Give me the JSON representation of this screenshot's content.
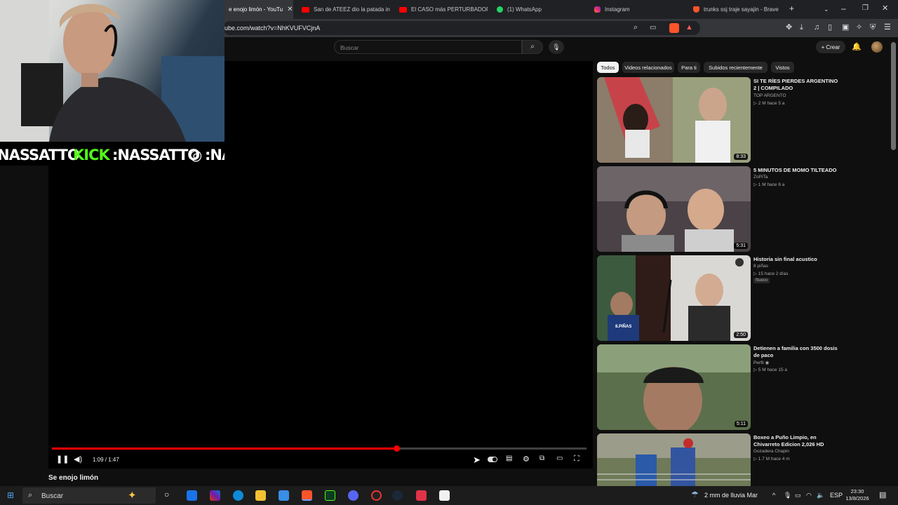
{
  "browser": {
    "tabs": [
      {
        "label": "e enojo limón - YouTu",
        "favicon": "youtube-icon",
        "color": "#ff0000",
        "active": true
      },
      {
        "label": "San de ATEEZ dio la patada in",
        "favicon": "youtube-icon",
        "color": "#ff0000"
      },
      {
        "label": "El CASO más PERTURBADOR d",
        "favicon": "youtube-icon",
        "color": "#ff0000"
      },
      {
        "label": "(1) WhatsApp",
        "favicon": "whatsapp-icon",
        "color": "#25d366"
      },
      {
        "label": "Instagram",
        "favicon": "instagram-icon",
        "color": "#e1306c"
      },
      {
        "label": "trunks ssj traje sayajin - Brave",
        "favicon": "brave-icon",
        "color": "#fb542b"
      }
    ],
    "url": "ube.com/watch?v=NhKVUFVCjnA"
  },
  "youtube": {
    "search_placeholder": "Buscar",
    "create_label": "Crear",
    "video_title": "Se enojo limón",
    "timecode": "1:09 / 1:47",
    "progress": 0.645
  },
  "webcam": {
    "banner_text_1": "NASSATTO",
    "banner_text_2": "KICK",
    "banner_text_3": ":NASSATTO",
    "banner_text_4": ":NA",
    "kick_color": "#53fc18"
  },
  "sidebar": {
    "chips": [
      "Todos",
      "Videos relacionados",
      "Para ti",
      "Subidos recientemente",
      "Vistos"
    ],
    "recommendations": [
      {
        "title": "SI TE RÍES PIERDES ARGENTINO 2 | COMPILADO",
        "channel": "TOP ARGENTO",
        "meta": "▷ 2 M   hace 5 a",
        "duration": "8:33"
      },
      {
        "title": "5 MINUTOS DE MOMO TILTEADO",
        "channel": "ZoPiTa",
        "meta": "▷ 1 M   hace 6 a",
        "duration": "5:31"
      },
      {
        "title": "Historia sin final acustico",
        "channel": "8 piñas",
        "meta": "▷ 15   hace 2 días",
        "duration": "2:50",
        "badge": "Nuevo",
        "overlay": "8.PIÑAS"
      },
      {
        "title": "Detienen a familia con 3500 dosis de paco",
        "channel": "Perfil",
        "meta": "▷ 5 M   hace 15 a",
        "duration": "5:11"
      },
      {
        "title": "Boxeo a Puño Limpio, en Chivarreto Edicion 2,026 HD",
        "channel": "Gozadera Chapin",
        "meta": "▷ 1.7 M   hace 4 m",
        "duration": ""
      }
    ]
  },
  "taskbar": {
    "search_label": "Buscar",
    "weather": "2 mm de lluvia Mar",
    "language": "ESP",
    "time": "23:30",
    "date": "13/8/2026"
  }
}
